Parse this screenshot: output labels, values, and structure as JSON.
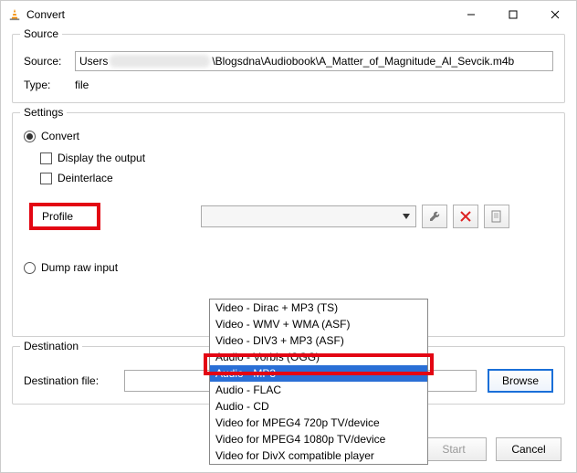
{
  "window": {
    "title": "Convert"
  },
  "source": {
    "group_label": "Source",
    "source_label": "Source:",
    "path_prefix": "Users",
    "path_suffix": "\\Blogsdna\\Audiobook\\A_Matter_of_Magnitude_Al_Sevcik.m4b",
    "type_label": "Type:",
    "type_value": "file"
  },
  "settings": {
    "group_label": "Settings",
    "convert_label": "Convert",
    "display_output_label": "Display the output",
    "deinterlace_label": "Deinterlace",
    "profile_label": "Profile",
    "dump_raw_label": "Dump raw input",
    "dropdown_options": [
      "Video - Dirac + MP3 (TS)",
      "Video - WMV + WMA (ASF)",
      "Video - DIV3 + MP3 (ASF)",
      "Audio - Vorbis (OGG)",
      "Audio - MP3",
      "Audio - FLAC",
      "Audio - CD",
      "Video for MPEG4 720p TV/device",
      "Video for MPEG4 1080p TV/device",
      "Video for DivX compatible player"
    ],
    "selected_option_index": 4
  },
  "destination": {
    "group_label": "Destination",
    "file_label": "Destination file:",
    "browse_label": "Browse"
  },
  "buttons": {
    "start": "Start",
    "cancel": "Cancel"
  },
  "icons": {
    "wrench": "wrench-icon",
    "delete": "delete-icon",
    "new_profile": "new-profile-icon"
  }
}
